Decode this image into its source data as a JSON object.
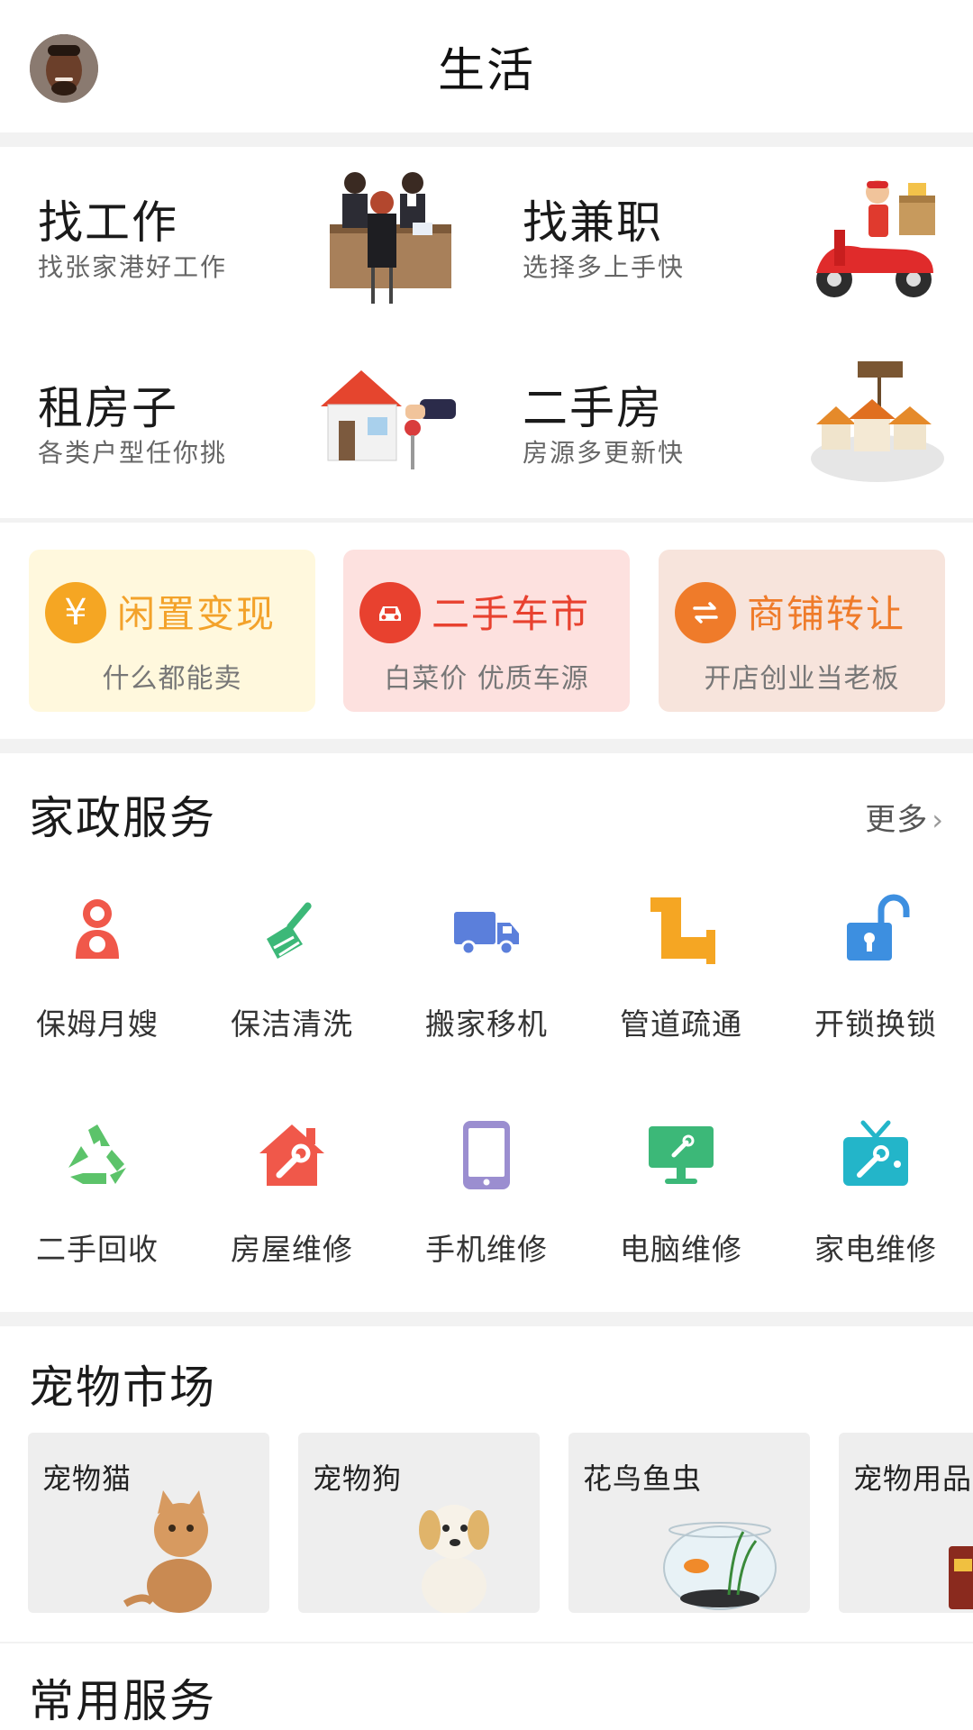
{
  "header": {
    "title": "生活",
    "avatar_icon": "user-avatar"
  },
  "quick_tiles": [
    {
      "title": "找工作",
      "subtitle": "找张家港好工作",
      "icon": "job-interview-illustration"
    },
    {
      "title": "找兼职",
      "subtitle": "选择多上手快",
      "icon": "delivery-scooter-illustration"
    },
    {
      "title": "租房子",
      "subtitle": "各类户型任你挑",
      "icon": "house-key-illustration"
    },
    {
      "title": "二手房",
      "subtitle": "房源多更新快",
      "icon": "houses-for-sale-illustration"
    }
  ],
  "promos": [
    {
      "title": "闲置变现",
      "subtitle": "什么都能卖",
      "icon": "yuan-icon",
      "color": "#f5a623"
    },
    {
      "title": "二手车市",
      "subtitle": "白菜价  优质车源",
      "icon": "car-icon",
      "color": "#e8412f"
    },
    {
      "title": "商铺转让",
      "subtitle": "开店创业当老板",
      "icon": "transfer-arrows-icon",
      "color": "#ef7b2a"
    }
  ],
  "housekeeping": {
    "title": "家政服务",
    "more_label": "更多",
    "items": [
      {
        "label": "保姆月嫂",
        "icon": "nanny-icon",
        "color": "#f0584a"
      },
      {
        "label": "保洁清洗",
        "icon": "broom-icon",
        "color": "#3cb878"
      },
      {
        "label": "搬家移机",
        "icon": "truck-icon",
        "color": "#5b7fdb"
      },
      {
        "label": "管道疏通",
        "icon": "pipe-icon",
        "color": "#f5a623"
      },
      {
        "label": "开锁换锁",
        "icon": "unlock-icon",
        "color": "#3d8fe0"
      },
      {
        "label": "二手回收",
        "icon": "recycle-icon",
        "color": "#5cc36a"
      },
      {
        "label": "房屋维修",
        "icon": "house-wrench-icon",
        "color": "#f0584a"
      },
      {
        "label": "手机维修",
        "icon": "phone-icon",
        "color": "#9b8ed0"
      },
      {
        "label": "电脑维修",
        "icon": "monitor-icon",
        "color": "#3cb878"
      },
      {
        "label": "家电维修",
        "icon": "tv-icon",
        "color": "#23b5c9"
      }
    ]
  },
  "pets": {
    "title": "宠物市场",
    "items": [
      {
        "label": "宠物猫",
        "icon": "cat-illustration"
      },
      {
        "label": "宠物狗",
        "icon": "dog-illustration"
      },
      {
        "label": "花鸟鱼虫",
        "icon": "fishbowl-illustration"
      },
      {
        "label": "宠物用品",
        "icon": "pet-food-illustration"
      }
    ]
  },
  "common": {
    "title": "常用服务"
  }
}
